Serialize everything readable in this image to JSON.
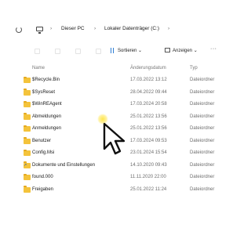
{
  "address_bar": {
    "breadcrumbs": [
      "Dieser PC",
      "Lokaler Datenträger (C:)"
    ],
    "separator": "›"
  },
  "toolbar": {
    "sort_label": "Sortieren",
    "view_label": "Anzeigen",
    "more_label": "···"
  },
  "columns": {
    "name": "Name",
    "date": "Änderungsdatum",
    "type": "Typ"
  },
  "files": [
    {
      "name": "$Recycle.Bin",
      "date": "17.03.2022 13:12",
      "type": "Dateiordner",
      "icon": "folder-icon"
    },
    {
      "name": "$SysReset",
      "date": "28.04.2022 09:44",
      "type": "Dateiordner",
      "icon": "folder-icon"
    },
    {
      "name": "$WinREAgent",
      "date": "17.03.2024 20:58",
      "type": "Dateiordner",
      "icon": "folder-icon"
    },
    {
      "name": "Abmeldungen",
      "date": "25.01.2022 13:56",
      "type": "Dateiordner",
      "icon": "folder-icon"
    },
    {
      "name": "Anmeldungen",
      "date": "25.01.2022 13:56",
      "type": "Dateiordner",
      "icon": "folder-icon"
    },
    {
      "name": "Benutzer",
      "date": "17.03.2024 09:53",
      "type": "Dateiordner",
      "icon": "folder-icon"
    },
    {
      "name": "Config.Msi",
      "date": "23.01.2024 15:54",
      "type": "Dateiordner",
      "icon": "folder-icon"
    },
    {
      "name": "Dokumente und Einstellungen",
      "date": "14.10.2020 09:43",
      "type": "Dateiordner",
      "icon": "shortcut-folder-icon"
    },
    {
      "name": "found.000",
      "date": "11.11.2020 22:00",
      "type": "Dateiordner",
      "icon": "folder-icon"
    },
    {
      "name": "Freigaben",
      "date": "25.01.2022 11:24",
      "type": "Dateiordner",
      "icon": "folder-icon"
    }
  ],
  "selected_row_index": 3,
  "colors": {
    "folder": "#f4c33b",
    "accent": "#2b7cd3",
    "highlight": "#ffe64d"
  }
}
